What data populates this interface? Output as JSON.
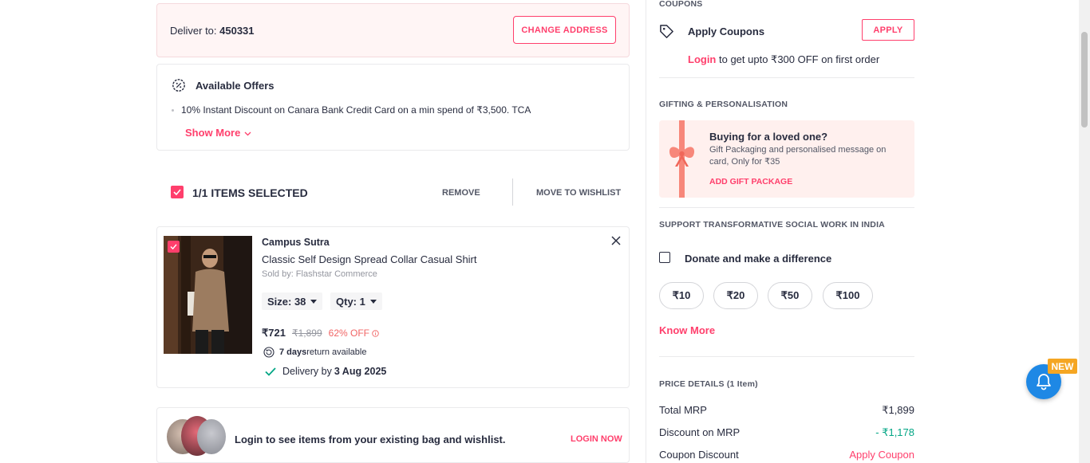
{
  "deliver": {
    "label": "Deliver to: ",
    "pincode": "450331",
    "change_label": "CHANGE ADDRESS"
  },
  "offers": {
    "title": "Available Offers",
    "item": "10% Instant Discount on Canara Bank Credit Card on a min spend of ₹3,500. TCA",
    "show_more": "Show More"
  },
  "selection": {
    "label": "1/1 ITEMS SELECTED",
    "remove": "REMOVE",
    "wishlist": "MOVE TO WISHLIST"
  },
  "item": {
    "brand": "Campus Sutra",
    "name": "Classic Self Design Spread Collar Casual Shirt",
    "seller": "Sold by: Flashstar Commerce",
    "size": "Size: 38",
    "qty": "Qty: 1",
    "price": "₹721",
    "mrp": "₹1,899",
    "discount": "62% OFF",
    "return_days": "7 days",
    "return_text": " return available",
    "delivery_label": "Delivery by ",
    "delivery_date": "3 Aug 2025"
  },
  "login_banner": {
    "text": "Login to see items from your existing bag and wishlist.",
    "button": "LOGIN NOW"
  },
  "coupons": {
    "section": "COUPONS",
    "title": "Apply Coupons",
    "apply": "APPLY",
    "login": "Login",
    "login_text": " to get upto ₹300 OFF on first order"
  },
  "gifting": {
    "section": "GIFTING & PERSONALISATION",
    "title": "Buying for a loved one?",
    "desc": "Gift Packaging and personalised message on card, Only for ₹35",
    "cta": "ADD GIFT PACKAGE"
  },
  "donate": {
    "section": "SUPPORT TRANSFORMATIVE SOCIAL WORK IN INDIA",
    "label": "Donate and make a difference",
    "amounts": [
      "₹10",
      "₹20",
      "₹50",
      "₹100"
    ],
    "know_more": "Know More"
  },
  "price": {
    "section": "PRICE DETAILS (1 Item)",
    "rows": [
      {
        "label": "Total MRP",
        "value": "₹1,899"
      },
      {
        "label": "Discount on MRP",
        "value": "- ₹1,178"
      },
      {
        "label": "Coupon Discount",
        "value": "Apply Coupon"
      }
    ]
  },
  "notify": {
    "badge": "NEW"
  },
  "colors": {
    "brand": "#ff3f6c",
    "green": "#03a685",
    "discount": "#f16565"
  }
}
